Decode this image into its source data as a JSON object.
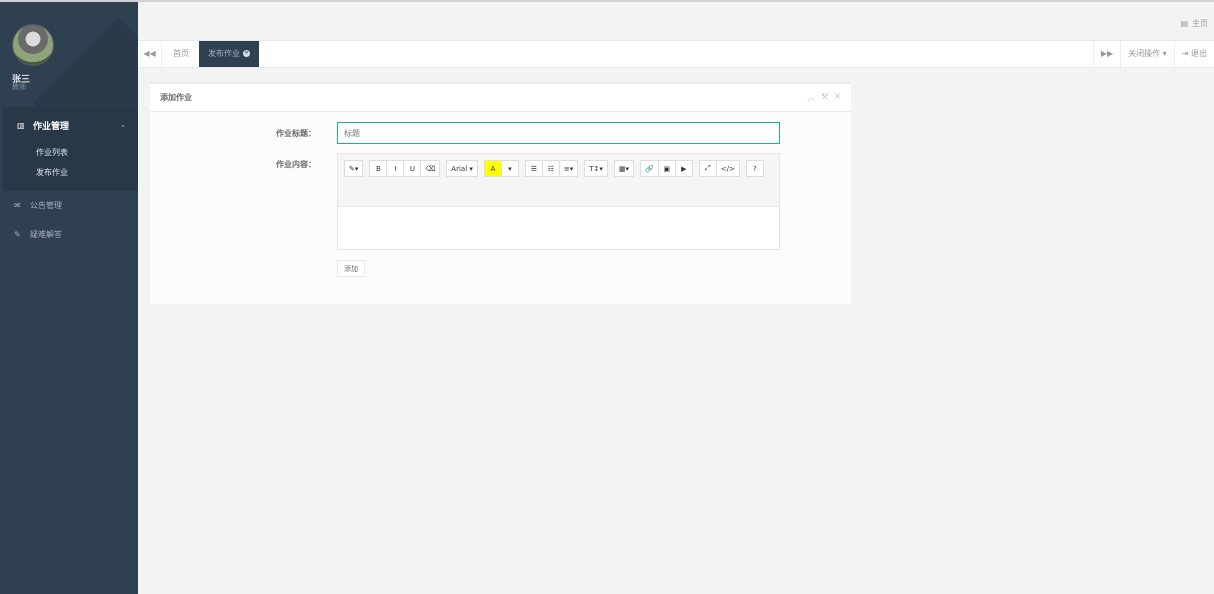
{
  "user": {
    "name": "张三",
    "role": "教师"
  },
  "nav": {
    "group": {
      "icon": "bar-chart-icon",
      "label": "作业管理",
      "items": [
        "作业列表",
        "发布作业"
      ]
    },
    "items": [
      {
        "icon": "envelope-icon",
        "label": "公告管理"
      },
      {
        "icon": "edit-icon",
        "label": "疑难解答"
      }
    ]
  },
  "topbar": {
    "home_icon": "home-icon",
    "home_label": "主页"
  },
  "tabs": {
    "items": [
      {
        "label": "首页",
        "active": false
      },
      {
        "label": "发布作业",
        "active": true
      }
    ],
    "close_label": "关闭操作",
    "logout_label": "退出"
  },
  "panel": {
    "title": "添加作业",
    "form": {
      "title_label": "作业标题：",
      "title_placeholder": "标题",
      "content_label": "作业内容：",
      "submit_label": "添加"
    },
    "toolbar": {
      "groups": [
        [
          "✎▾"
        ],
        [
          "B",
          "I",
          "U",
          "⌫"
        ],
        [
          "Arial ▾"
        ],
        [
          "A",
          "▾"
        ],
        [
          "☰",
          "☷",
          "≡▾"
        ],
        [
          "T↕▾"
        ],
        [
          "▦▾"
        ],
        [
          "🔗",
          "▣",
          "▶"
        ],
        [
          "⤢",
          "</>"
        ],
        [
          "?"
        ]
      ]
    }
  }
}
